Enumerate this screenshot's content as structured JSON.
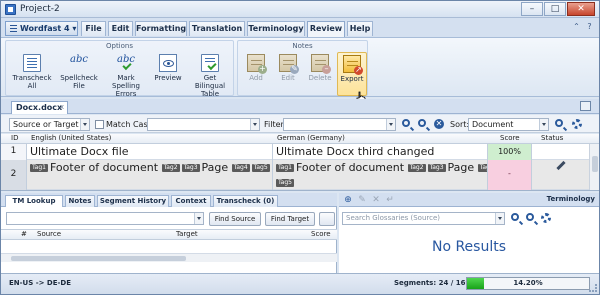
{
  "window": {
    "title": "Project-2"
  },
  "menu": {
    "app_menu": "Wordfast 4",
    "tabs": [
      "File",
      "Edit",
      "Formatting",
      "Translation",
      "Terminology",
      "Review",
      "Help"
    ],
    "active_tab": "Review"
  },
  "ribbon": {
    "options_group": "Options",
    "notes_group": "Notes",
    "buttons": {
      "transcheck": "Transcheck All",
      "spellcheck": "Spellcheck File",
      "mark_spelling": "Mark Spelling Errors",
      "preview": "Preview",
      "bilingual": "Get Bilingual Table",
      "add": "Add",
      "edit": "Edit",
      "delete": "Delete",
      "export": "Export"
    }
  },
  "document": {
    "tab_name": "Docx.docx",
    "tab_close": "x"
  },
  "filter_bar": {
    "view_select": "Source or Target",
    "match_case_label": "Match Case",
    "filter_label": "Filter:",
    "sort_label": "Sort:",
    "sort_value": "Document"
  },
  "grid": {
    "headers": {
      "id": "ID",
      "source": "English (United States)",
      "target": "German (Germany)",
      "score": "Score",
      "status": "Status"
    },
    "rows": [
      {
        "num": "1",
        "source_text": "Ultimate Docx file",
        "target_text": "Ultimate Docx third changed",
        "score": "100%"
      },
      {
        "num": "2",
        "source_text": "Footer of document",
        "source_page": "Page",
        "target_text": "Footer of document",
        "target_page": "Page",
        "score": "-",
        "tags": {
          "t1": "Tag1",
          "t2": "Tag2",
          "t3": "Tag3",
          "t4": "Tag4",
          "t5": "Tag5"
        }
      }
    ]
  },
  "bottom_tabs": [
    "TM Lookup",
    "Notes",
    "Segment History",
    "Context",
    "Transcheck (0)"
  ],
  "tm_lookup": {
    "find_source": "Find Source",
    "find_target": "Find Target",
    "columns": {
      "hash": "#",
      "source": "Source",
      "target": "Target",
      "score": "Score"
    }
  },
  "terminology": {
    "title": "Terminology",
    "search_placeholder": "Search Glossaries (Source)",
    "no_results": "No Results"
  },
  "statusbar": {
    "language_pair": "EN-US -> DE-DE",
    "segments": "Segments: 24 / 169",
    "progress_percent": "14.20%",
    "progress_value": 14.2
  }
}
